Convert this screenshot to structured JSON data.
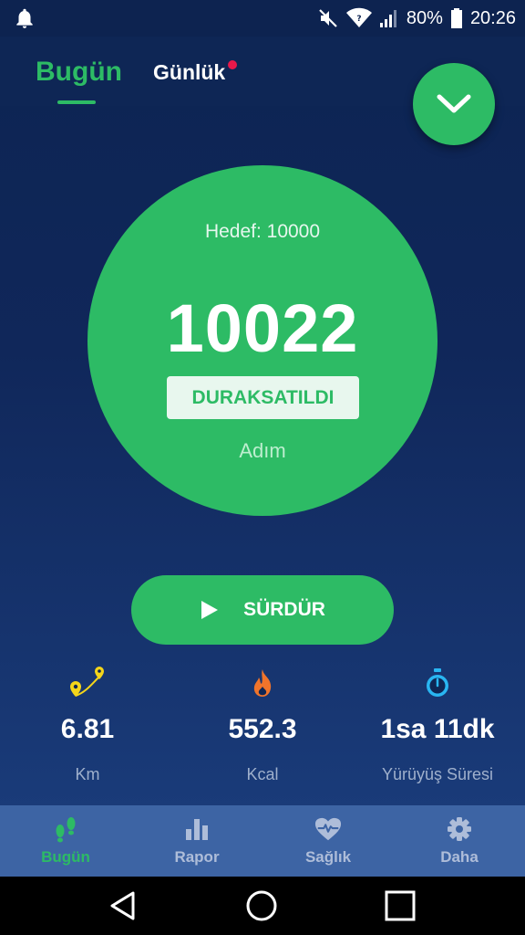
{
  "status_bar": {
    "battery": "80%",
    "time": "20:26",
    "icons": [
      "notification-bell-icon",
      "mute-icon",
      "wifi-icon",
      "signal-icon",
      "battery-icon"
    ]
  },
  "tabs": {
    "today": "Bugün",
    "daily": "Günlük"
  },
  "steps": {
    "goal": "Hedef: 10000",
    "count": "10022",
    "state": "DURAKSATILDI",
    "unit": "Adım"
  },
  "resume_button": {
    "label": "SÜRDÜR"
  },
  "stats": [
    {
      "icon": "route-pin-icon",
      "value": "6.81",
      "label": "Km"
    },
    {
      "icon": "flame-icon",
      "value": "552.3",
      "label": "Kcal"
    },
    {
      "icon": "stopwatch-icon",
      "value": "1sa 11dk",
      "label": "Yürüyüş Süresi"
    }
  ],
  "bottom_nav": [
    {
      "icon": "footsteps-icon",
      "label": "Bugün",
      "active": true
    },
    {
      "icon": "bar-chart-icon",
      "label": "Rapor",
      "active": false
    },
    {
      "icon": "heart-pulse-icon",
      "label": "Sağlık",
      "active": false
    },
    {
      "icon": "gear-icon",
      "label": "Daha",
      "active": false
    }
  ],
  "colors": {
    "accent": "#2dbb65",
    "background": "#0e2655",
    "nav_background": "#3d64a4",
    "notification_dot": "#e8184a"
  }
}
